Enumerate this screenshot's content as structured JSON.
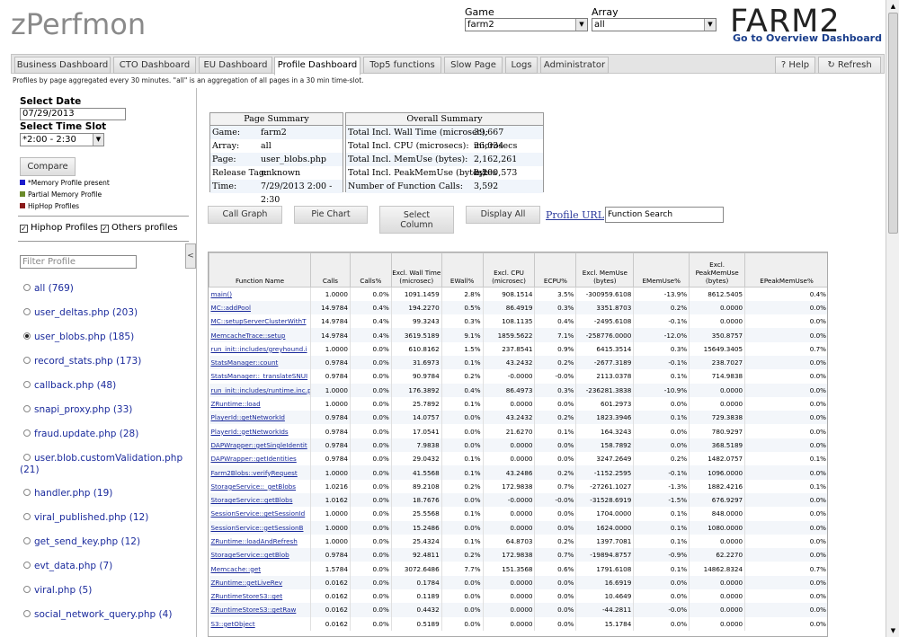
{
  "header": {
    "logo": "zPerfmon",
    "game_label": "Game",
    "game_value": "farm2",
    "array_label": "Array",
    "array_value": "all",
    "brand": "FARM2",
    "overview_link": "Go to Overview Dashboard"
  },
  "tabs": [
    "Business Dashboard",
    "CTO Dashboard",
    "EU Dashboard",
    "Profile Dashboard",
    "Top5 functions",
    "Slow Page",
    "Logs",
    "Administrator"
  ],
  "active_tab": "Profile Dashboard",
  "right_tabs": {
    "help": "Help",
    "refresh": "Refresh",
    "help_icon": "?",
    "refresh_icon": "↻"
  },
  "description": "Profiles by page aggregated every 30 minutes. \"all\" is an aggregation of all pages in a 30 min time-slot.",
  "left": {
    "select_date_label": "Select Date",
    "date_value": "07/29/2013",
    "select_slot_label": "Select Time Slot",
    "slot_value": "*2:00 - 2:30",
    "compare_label": "Compare",
    "legend": [
      {
        "label": "*Memory Profile present",
        "color": "#1c1ccc"
      },
      {
        "label": "Partial Memory Profile",
        "color": "#6a8a2a"
      },
      {
        "label": "HipHop Profiles",
        "color": "#8a1a1a"
      }
    ],
    "hiphop_label": "Hiphop Profiles",
    "others_label": "Others profiles",
    "filter_placeholder": "Filter Profile",
    "collapse_icon": "<",
    "profiles": [
      {
        "label": "all (769)",
        "selected": false
      },
      {
        "label": "user_deltas.php (203)",
        "selected": false
      },
      {
        "label": "user_blobs.php (185)",
        "selected": true
      },
      {
        "label": "record_stats.php (173)",
        "selected": false
      },
      {
        "label": "callback.php (48)",
        "selected": false
      },
      {
        "label": "snapi_proxy.php (33)",
        "selected": false
      },
      {
        "label": "fraud.update.php (28)",
        "selected": false
      },
      {
        "label": "user.blob.customValidation.php",
        "label2": "(21)",
        "selected": false
      },
      {
        "label": "handler.php (19)",
        "selected": false
      },
      {
        "label": "viral_published.php (12)",
        "selected": false
      },
      {
        "label": "get_send_key.php (12)",
        "selected": false
      },
      {
        "label": "evt_data.php (7)",
        "selected": false
      },
      {
        "label": "viral.php (5)",
        "selected": false
      },
      {
        "label": "social_network_query.php (4)",
        "selected": false
      }
    ]
  },
  "page_summary": {
    "title": "Page Summary",
    "rows": [
      {
        "k": "Game:",
        "v": "farm2"
      },
      {
        "k": "Array:",
        "v": "all"
      },
      {
        "k": "Page:",
        "v": "user_blobs.php"
      },
      {
        "k": "Release Tag:",
        "v": "unknown"
      },
      {
        "k": "Time:",
        "v": "7/29/2013 2:00 - 2:30"
      }
    ]
  },
  "overall_summary": {
    "title": "Overall Summary",
    "rows": [
      {
        "k": "Total Incl. Wall Time (microsec):",
        "v": "39,667 microsecs"
      },
      {
        "k": "Total Incl. CPU (microsecs):",
        "v": "26,034 microsecs"
      },
      {
        "k": "Total Incl. MemUse (bytes):",
        "v": "2,162,261 bytes"
      },
      {
        "k": "Total Incl. PeakMemUse (bytes):",
        "v": "2,200,573 bytes"
      },
      {
        "k": "Number of Function Calls:",
        "v": "3,592"
      }
    ]
  },
  "buttons": {
    "call_graph": "Call Graph",
    "pie_chart": "Pie Chart",
    "select_column_1": "Select",
    "select_column_2": "Column",
    "display_all": "Display All",
    "profile_url": "Profile URL",
    "function_search": "Function Search"
  },
  "table": {
    "headers": [
      "Function Name",
      "Calls",
      "Calls%",
      "Excl. Wall Time (microsec)",
      "EWall%",
      "Excl. CPU (microsec)",
      "ECPU%",
      "Excl. MemUse (bytes)",
      "EMemUse%",
      "Excl. PeakMemUse (bytes)",
      "EPeakMemUse%"
    ],
    "rows": [
      [
        "main()",
        "1.0000",
        "0.0%",
        "1091.1459",
        "2.8%",
        "908.1514",
        "3.5%",
        "-300959.6108",
        "-13.9%",
        "8612.5405",
        "0.4%"
      ],
      [
        "MC::addPool",
        "14.9784",
        "0.4%",
        "194.2270",
        "0.5%",
        "86.4919",
        "0.3%",
        "3351.8703",
        "0.2%",
        "0.0000",
        "0.0%"
      ],
      [
        "MC::setupServerClusterWithT",
        "14.9784",
        "0.4%",
        "99.3243",
        "0.3%",
        "108.1135",
        "0.4%",
        "-2495.6108",
        "-0.1%",
        "0.0000",
        "0.0%"
      ],
      [
        "MemcacheTrace::setup",
        "14.9784",
        "0.4%",
        "3619.5189",
        "9.1%",
        "1859.5622",
        "7.1%",
        "-258776.0000",
        "-12.0%",
        "350.8757",
        "0.0%"
      ],
      [
        "run_init::includes/greyhound.i",
        "1.0000",
        "0.0%",
        "610.8162",
        "1.5%",
        "237.8541",
        "0.9%",
        "6415.3514",
        "0.3%",
        "15649.3405",
        "0.7%"
      ],
      [
        "StatsManager::count",
        "0.9784",
        "0.0%",
        "31.6973",
        "0.1%",
        "43.2432",
        "0.2%",
        "-2677.3189",
        "-0.1%",
        "238.7027",
        "0.0%"
      ],
      [
        "StatsManager::_translateSNUI",
        "0.9784",
        "0.0%",
        "90.9784",
        "0.2%",
        "-0.0000",
        "-0.0%",
        "2113.0378",
        "0.1%",
        "714.9838",
        "0.0%"
      ],
      [
        "run_init::includes/runtime.inc.p",
        "1.0000",
        "0.0%",
        "176.3892",
        "0.4%",
        "86.4973",
        "0.3%",
        "-236281.3838",
        "-10.9%",
        "0.0000",
        "0.0%"
      ],
      [
        "ZRuntime::load",
        "1.0000",
        "0.0%",
        "25.7892",
        "0.1%",
        "0.0000",
        "0.0%",
        "601.2973",
        "0.0%",
        "0.0000",
        "0.0%"
      ],
      [
        "PlayerId::getNetworkId",
        "0.9784",
        "0.0%",
        "14.0757",
        "0.0%",
        "43.2432",
        "0.2%",
        "1823.3946",
        "0.1%",
        "729.3838",
        "0.0%"
      ],
      [
        "PlayerId::getNetworkIds",
        "0.9784",
        "0.0%",
        "17.0541",
        "0.0%",
        "21.6270",
        "0.1%",
        "164.3243",
        "0.0%",
        "780.9297",
        "0.0%"
      ],
      [
        "DAPWrapper::getSingleIdentit",
        "0.9784",
        "0.0%",
        "7.9838",
        "0.0%",
        "0.0000",
        "0.0%",
        "158.7892",
        "0.0%",
        "368.5189",
        "0.0%"
      ],
      [
        "DAPWrapper::getIdentities",
        "0.9784",
        "0.0%",
        "29.0432",
        "0.1%",
        "0.0000",
        "0.0%",
        "3247.2649",
        "0.2%",
        "1482.0757",
        "0.1%"
      ],
      [
        "Farm2Blobs::verifyRequest",
        "1.0000",
        "0.0%",
        "41.5568",
        "0.1%",
        "43.2486",
        "0.2%",
        "-1152.2595",
        "-0.1%",
        "1096.0000",
        "0.0%"
      ],
      [
        "StorageService::_getBlobs",
        "1.0216",
        "0.0%",
        "89.2108",
        "0.2%",
        "172.9838",
        "0.7%",
        "-27261.1027",
        "-1.3%",
        "1882.4216",
        "0.1%"
      ],
      [
        "StorageService::getBlobs",
        "1.0162",
        "0.0%",
        "18.7676",
        "0.0%",
        "-0.0000",
        "-0.0%",
        "-31528.6919",
        "-1.5%",
        "676.9297",
        "0.0%"
      ],
      [
        "SessionService::getSessionId",
        "1.0000",
        "0.0%",
        "25.5568",
        "0.1%",
        "0.0000",
        "0.0%",
        "1704.0000",
        "0.1%",
        "848.0000",
        "0.0%"
      ],
      [
        "SessionService::getSessionB",
        "1.0000",
        "0.0%",
        "15.2486",
        "0.0%",
        "0.0000",
        "0.0%",
        "1624.0000",
        "0.1%",
        "1080.0000",
        "0.0%"
      ],
      [
        "ZRuntime::loadAndRefresh",
        "1.0000",
        "0.0%",
        "25.4324",
        "0.1%",
        "64.8703",
        "0.2%",
        "1397.7081",
        "0.1%",
        "0.0000",
        "0.0%"
      ],
      [
        "StorageService::getBlob",
        "0.9784",
        "0.0%",
        "92.4811",
        "0.2%",
        "172.9838",
        "0.7%",
        "-19894.8757",
        "-0.9%",
        "62.2270",
        "0.0%"
      ],
      [
        "Memcache::get",
        "1.5784",
        "0.0%",
        "3072.6486",
        "7.7%",
        "151.3568",
        "0.6%",
        "1791.6108",
        "0.1%",
        "14862.8324",
        "0.7%"
      ],
      [
        "ZRuntime::getLiveRev",
        "0.0162",
        "0.0%",
        "0.1784",
        "0.0%",
        "0.0000",
        "0.0%",
        "16.6919",
        "0.0%",
        "0.0000",
        "0.0%"
      ],
      [
        "ZRuntimeStoreS3::get",
        "0.0162",
        "0.0%",
        "0.1189",
        "0.0%",
        "0.0000",
        "0.0%",
        "10.4649",
        "0.0%",
        "0.0000",
        "0.0%"
      ],
      [
        "ZRuntimeStoreS3::getRaw",
        "0.0162",
        "0.0%",
        "0.4432",
        "0.0%",
        "0.0000",
        "0.0%",
        "-44.2811",
        "-0.0%",
        "0.0000",
        "0.0%"
      ],
      [
        "S3::getObject",
        "0.0162",
        "0.0%",
        "0.5189",
        "0.0%",
        "0.0000",
        "0.0%",
        "15.1784",
        "0.0%",
        "0.0000",
        "0.0%"
      ]
    ]
  }
}
